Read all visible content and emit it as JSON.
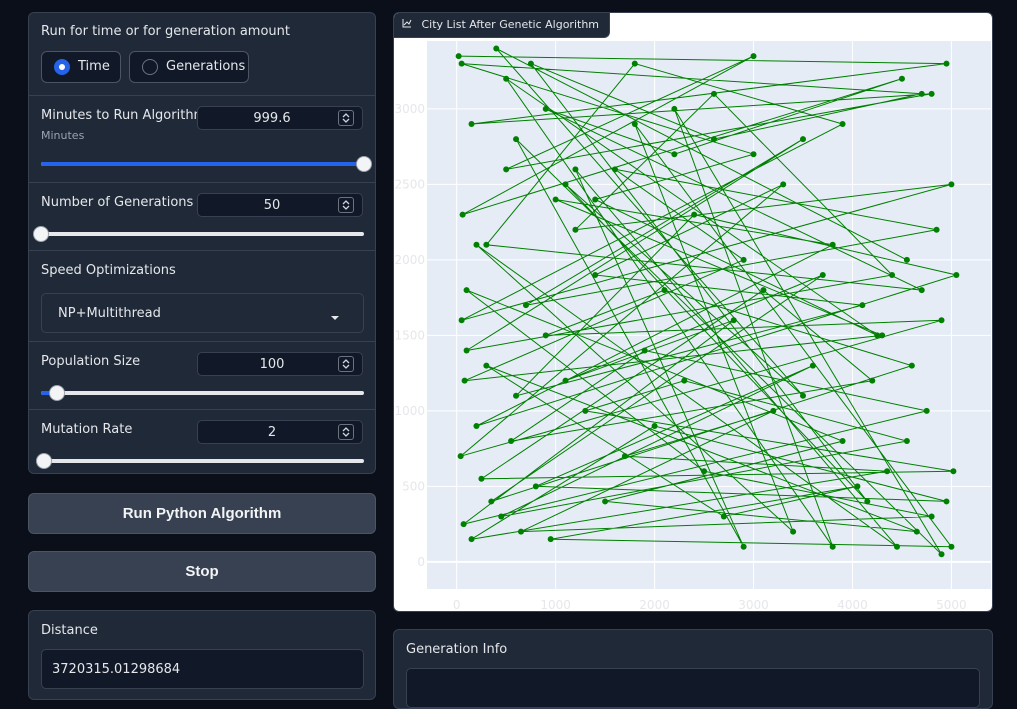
{
  "run_mode": {
    "label": "Run for time or for generation amount",
    "options": [
      "Time",
      "Generations"
    ],
    "selected": "Time"
  },
  "minutes": {
    "label": "Minutes to Run Algorithm",
    "sublabel": "Minutes",
    "value": "999.6",
    "slider_fraction": 1.0
  },
  "generations": {
    "label": "Number of Generations",
    "value": "50",
    "slider_fraction": 0.0
  },
  "speed": {
    "label": "Speed Optimizations",
    "selected": "NP+Multithread"
  },
  "population": {
    "label": "Population Size",
    "value": "100",
    "slider_fraction": 0.05
  },
  "mutation": {
    "label": "Mutation Rate",
    "value": "2",
    "slider_fraction": 0.01
  },
  "buttons": {
    "run": "Run Python Algorithm",
    "stop": "Stop"
  },
  "distance": {
    "label": "Distance",
    "value": "3720315.01298684"
  },
  "generation_info": {
    "label": "Generation Info"
  },
  "plot": {
    "tab_label": "City List After Genetic Algorithm",
    "line_color": "#008000",
    "bg_color": "#e5ecf6",
    "chart_data": {
      "type": "line",
      "title": "",
      "xlabel": "",
      "ylabel": "",
      "xlim": [
        -300,
        5400
      ],
      "ylim": [
        -180,
        3450
      ],
      "x_ticks": [
        0,
        1000,
        2000,
        3000,
        4000,
        5000
      ],
      "y_ticks": [
        0,
        500,
        1000,
        1500,
        2000,
        2500,
        3000
      ],
      "grid": true,
      "series": [
        {
          "mode": "lines+markers",
          "color": "#008000",
          "x": [
            20,
            4950,
            150,
            4800,
            500,
            3000,
            60,
            4500,
            2200,
            900,
            4700,
            300,
            1800,
            3900,
            50,
            5000,
            1200,
            2600,
            4400,
            100,
            3500,
            700,
            4850,
            1600,
            2900,
            80,
            4300,
            1000,
            3800,
            200,
            5050,
            2400,
            600,
            4100,
            1400,
            3300,
            40,
            4900,
            900,
            2100,
            4600,
            350,
            3700,
            1100,
            2800,
            70,
            4750,
            1900,
            550,
            4200,
            3100,
            250,
            5020,
            1300,
            2300,
            4550,
            450,
            3600,
            800,
            4950,
            2000,
            150,
            4350,
            1700,
            3200,
            650,
            4800,
            2500,
            100,
            3900,
            1500,
            4650,
            300,
            2700,
            4050,
            950,
            5000,
            1800,
            3400,
            200,
            4450,
            1200,
            2900,
            600,
            4900,
            2200,
            3800,
            500,
            4250,
            1400,
            3000,
            50,
            4700,
            2600,
            750,
            4150,
            1100,
            3500,
            400,
            4550
          ],
          "y": [
            3350,
            3300,
            2900,
            3100,
            2600,
            3350,
            2300,
            3200,
            2700,
            3000,
            1800,
            2100,
            3300,
            2900,
            1600,
            2500,
            2200,
            3100,
            1900,
            1400,
            2800,
            1700,
            2200,
            2600,
            2000,
            1200,
            1500,
            2400,
            2100,
            900,
            1900,
            2300,
            1100,
            1700,
            1900,
            2500,
            700,
            1600,
            1500,
            1800,
            1300,
            400,
            1900,
            1200,
            1600,
            250,
            1000,
            1400,
            800,
            1200,
            1800,
            550,
            600,
            1000,
            1200,
            800,
            300,
            1300,
            500,
            400,
            900,
            150,
            600,
            700,
            1000,
            200,
            300,
            600,
            1800,
            800,
            400,
            200,
            1300,
            300,
            500,
            150,
            100,
            2900,
            200,
            2100,
            100,
            2600,
            100,
            2800,
            50,
            3000,
            100,
            3200,
            1500,
            2400,
            2700,
            3300,
            3100,
            2800,
            3300,
            400,
            2500,
            1100,
            3400,
            2000
          ]
        }
      ]
    }
  }
}
